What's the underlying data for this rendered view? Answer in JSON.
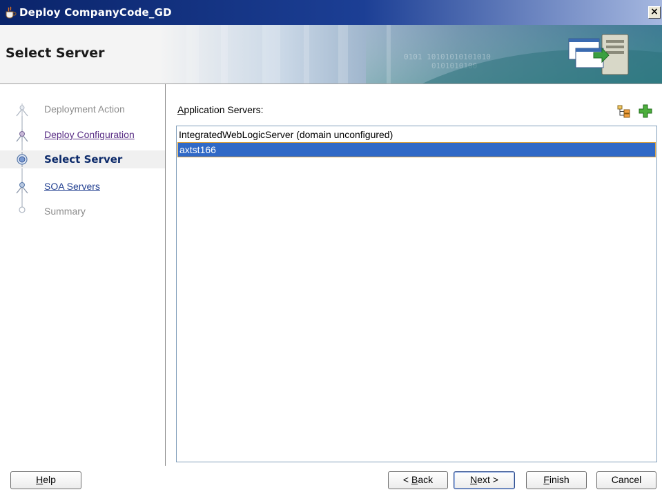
{
  "window": {
    "title": "Deploy CompanyCode_GD",
    "close_glyph": "×"
  },
  "header": {
    "title": "Select Server"
  },
  "train": {
    "steps": [
      {
        "label": "Deployment Action",
        "state": "visited-disabled",
        "icon": "train-step-icon"
      },
      {
        "label": "Deploy Configuration",
        "state": "visited-link",
        "icon": "train-step-icon"
      },
      {
        "label": "Select Server",
        "state": "current",
        "icon": "train-step-current-icon"
      },
      {
        "label": "SOA Servers",
        "state": "link",
        "icon": "train-step-icon"
      },
      {
        "label": "Summary",
        "state": "disabled",
        "icon": "train-step-end-icon"
      }
    ]
  },
  "content": {
    "list_label_prefix": "A",
    "list_label_rest": "pplication Servers:",
    "toolbar": {
      "browse_icon": "server-tree-icon",
      "add_icon": "add-icon"
    },
    "servers": [
      {
        "name": "IntegratedWebLogicServer (domain unconfigured)",
        "selected": false
      },
      {
        "name": "axtst166",
        "selected": true
      }
    ]
  },
  "buttons": {
    "help": {
      "before": "",
      "mnemonic": "H",
      "after": "elp"
    },
    "back": {
      "before": "< ",
      "mnemonic": "B",
      "after": "ack"
    },
    "next": {
      "before": "",
      "mnemonic": "N",
      "after": "ext >"
    },
    "finish": {
      "before": "",
      "mnemonic": "F",
      "after": "inish"
    },
    "cancel": {
      "before": "Cancel",
      "mnemonic": "",
      "after": ""
    }
  },
  "colors": {
    "selection": "#3169c6",
    "selection_border": "#d8a040",
    "title_bar": "#0a246a"
  }
}
